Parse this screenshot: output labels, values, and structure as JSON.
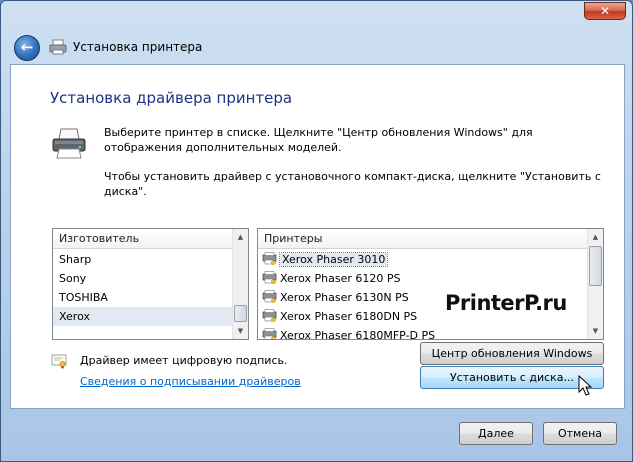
{
  "window": {
    "title": "Установка принтера",
    "close_label": "✕"
  },
  "heading": "Установка драйвера принтера",
  "description": {
    "line1": "Выберите принтер в списке. Щелкните \"Центр обновления Windows\" для отображения дополнительных моделей.",
    "line2": "Чтобы установить драйвер с установочного компакт-диска, щелкните \"Установить с диска\"."
  },
  "manufacturers": {
    "header": "Изготовитель",
    "items": [
      "Sharp",
      "Sony",
      "TOSHIBA",
      "Xerox"
    ],
    "selected": "Xerox"
  },
  "printers": {
    "header": "Принтеры",
    "items": [
      "Xerox Phaser 3010",
      "Xerox Phaser 6120 PS",
      "Xerox Phaser 6130N PS",
      "Xerox Phaser 6180DN PS",
      "Xerox Phaser 6180MFP-D PS"
    ],
    "selected": "Xerox Phaser 3010"
  },
  "watermark": "PrinterP.ru",
  "signature": {
    "status": "Драйвер имеет цифровую подпись.",
    "link": "Сведения о подписывании драйверов"
  },
  "buttons": {
    "windows_update": "Центр обновления Windows",
    "have_disk": "Установить с диска...",
    "next": "Далее",
    "cancel": "Отмена"
  },
  "colors": {
    "heading": "#1e3287",
    "link": "#0066cc",
    "selection": "#e3e9f2"
  }
}
